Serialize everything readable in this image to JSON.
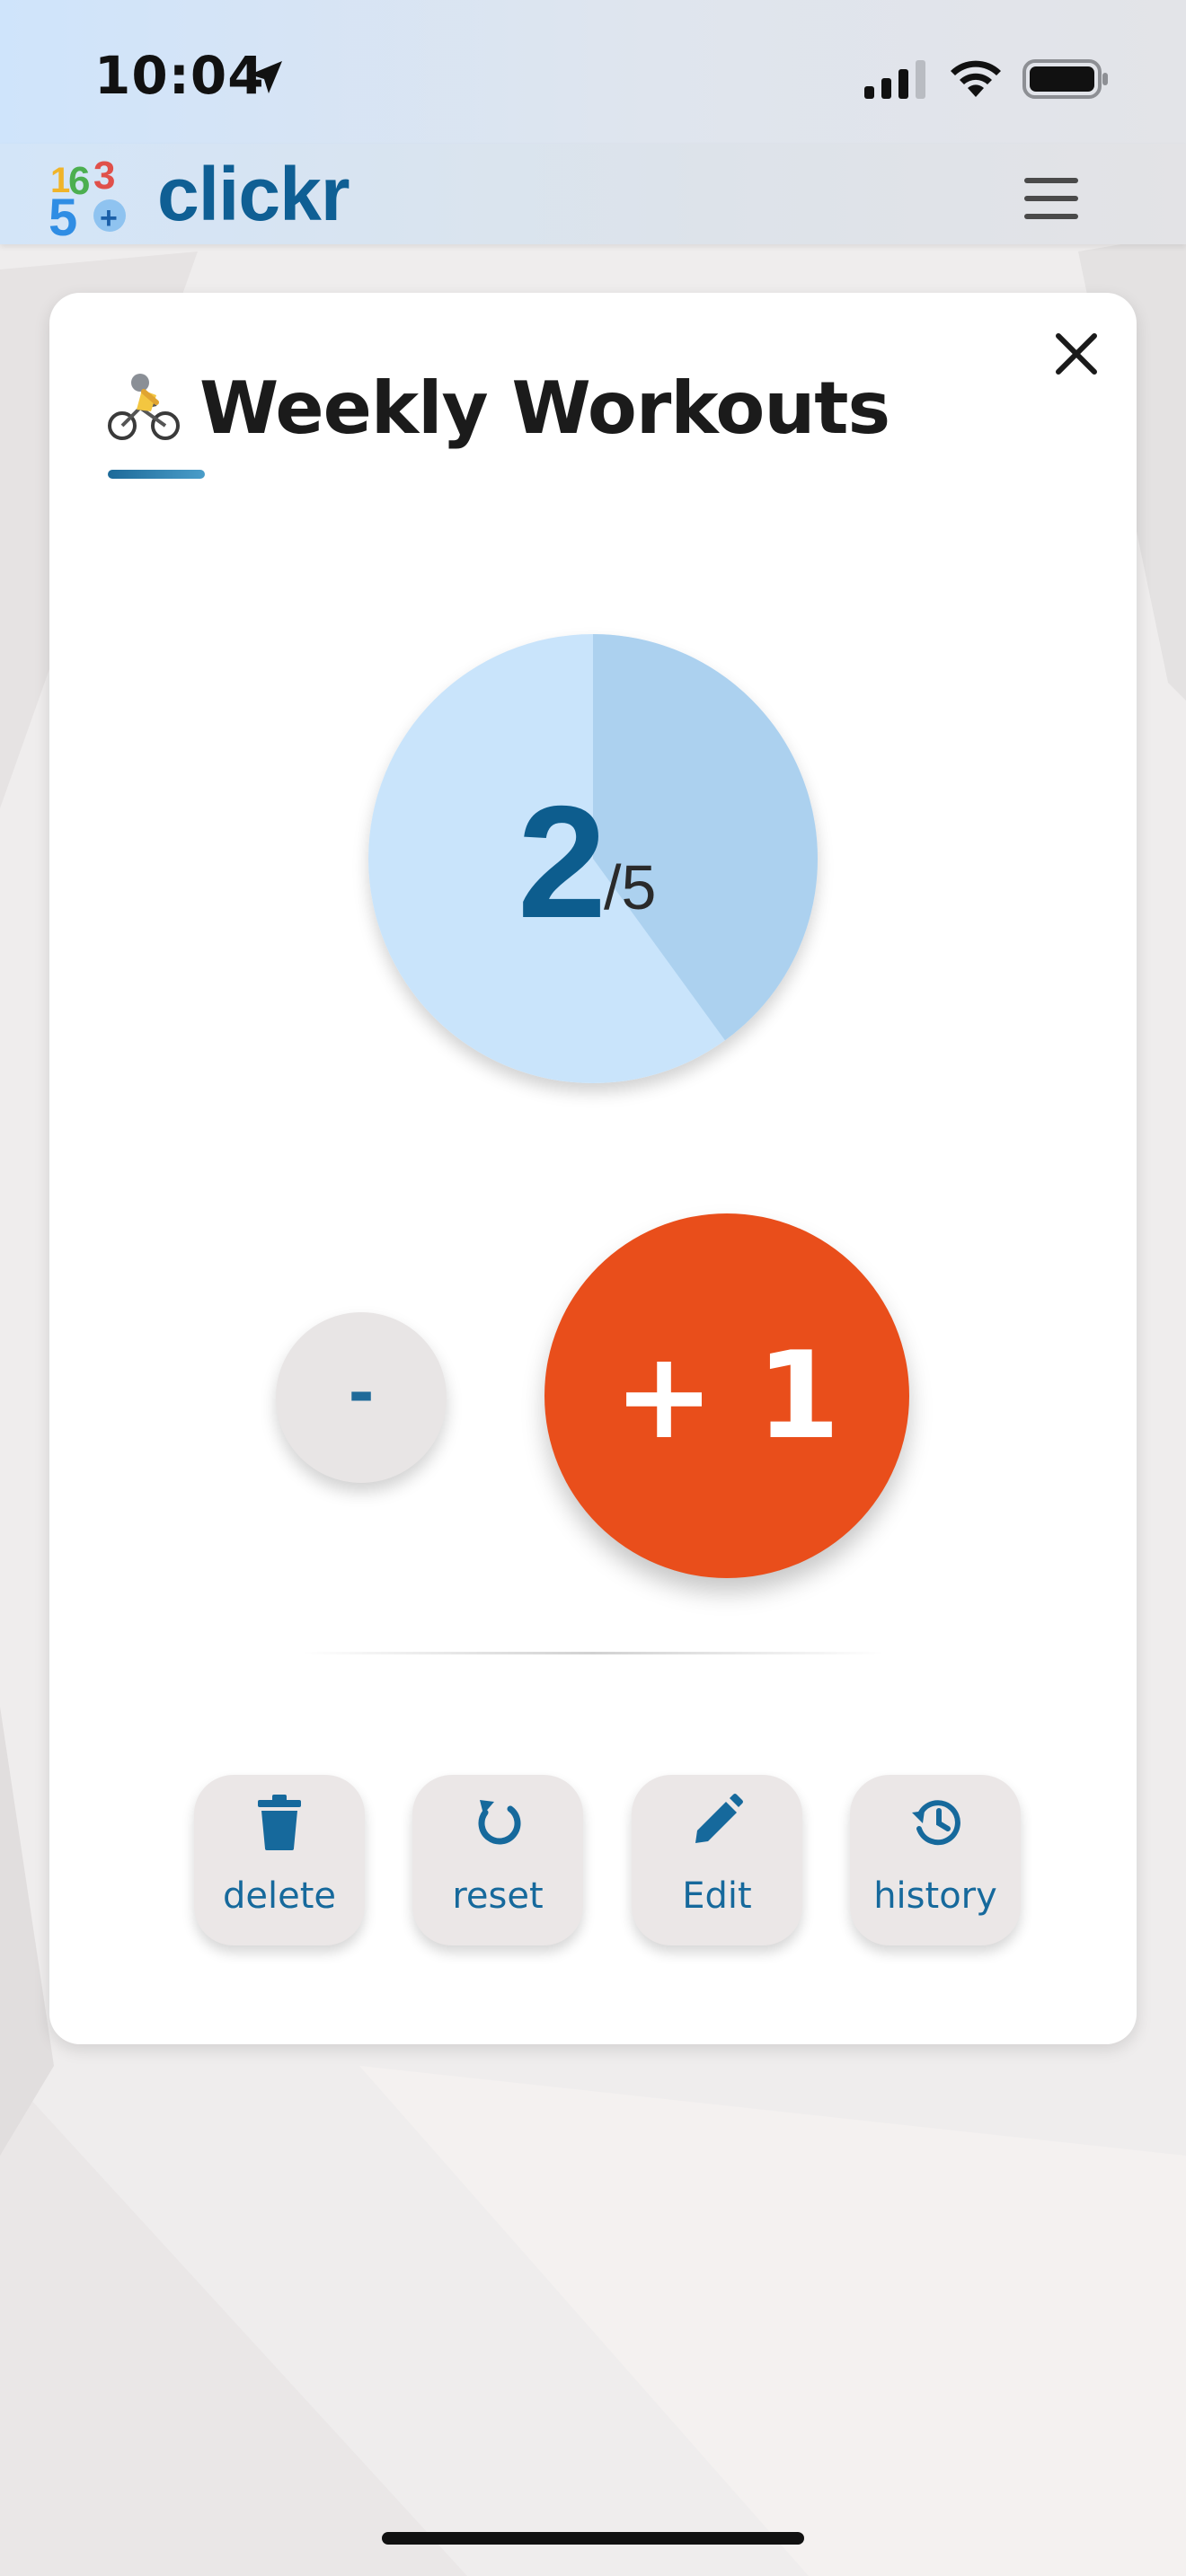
{
  "status_bar": {
    "time": "10:04"
  },
  "header": {
    "brand": "clickr",
    "logo_digits": [
      "1",
      "6",
      "3",
      "5",
      "+"
    ]
  },
  "counter": {
    "emoji_icon": "cyclist-icon",
    "title": "Weekly Workouts",
    "value": "2",
    "target_text": "/5",
    "progress_fraction": 0.4
  },
  "controls": {
    "decrement_label": "-",
    "increment_label": "+ 1"
  },
  "actions": [
    {
      "label": "delete",
      "icon": "trash-icon"
    },
    {
      "label": "reset",
      "icon": "refresh-icon"
    },
    {
      "label": "Edit",
      "icon": "pencil-icon"
    },
    {
      "label": "history",
      "icon": "history-icon"
    }
  ],
  "colors": {
    "brand": "#0f5f94",
    "increment": "#e94e1b",
    "pie_bg": "#c9e4fb",
    "pie_fill": "#acd1ef"
  }
}
